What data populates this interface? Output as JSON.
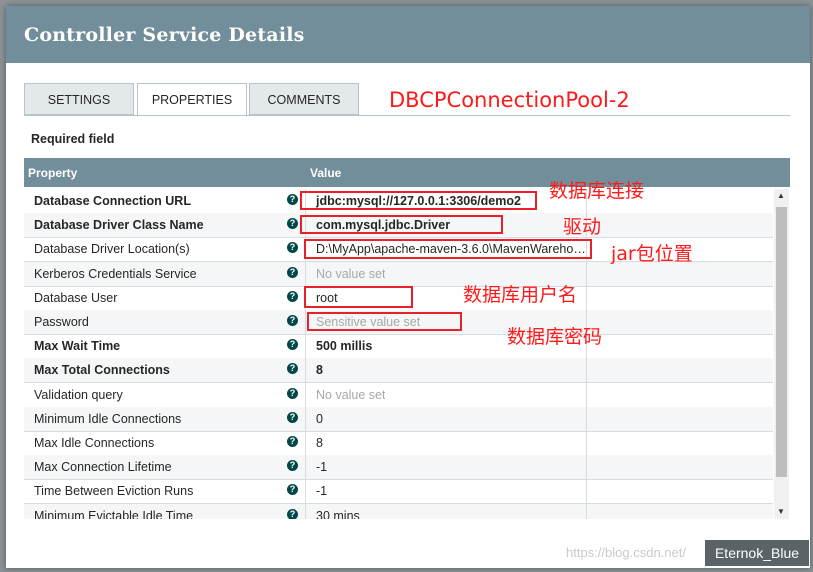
{
  "dialog": {
    "title": "Controller Service Details"
  },
  "tabs": [
    {
      "label": "SETTINGS",
      "active": false
    },
    {
      "label": "PROPERTIES",
      "active": true
    },
    {
      "label": "COMMENTS",
      "active": false
    }
  ],
  "annotation_title": "DBCPConnectionPool-2",
  "required_label": "Required field",
  "table": {
    "headers": {
      "property": "Property",
      "value": "Value"
    },
    "rows": [
      {
        "name": "Database Connection URL",
        "value": "jdbc:mysql://127.0.0.1:3306/demo2",
        "required": true,
        "empty": false
      },
      {
        "name": "Database Driver Class Name",
        "value": "com.mysql.jdbc.Driver",
        "required": true,
        "empty": false
      },
      {
        "name": "Database Driver Location(s)",
        "value": "D:\\MyApp\\apache-maven-3.6.0\\MavenWarehous...",
        "required": false,
        "empty": false
      },
      {
        "name": "Kerberos Credentials Service",
        "value": "No value set",
        "required": false,
        "empty": true
      },
      {
        "name": "Database User",
        "value": "root",
        "required": false,
        "empty": false
      },
      {
        "name": "Password",
        "value": "Sensitive value set",
        "required": false,
        "empty": true
      },
      {
        "name": "Max Wait Time",
        "value": "500 millis",
        "required": true,
        "empty": false
      },
      {
        "name": "Max Total Connections",
        "value": "8",
        "required": true,
        "empty": false
      },
      {
        "name": "Validation query",
        "value": "No value set",
        "required": false,
        "empty": true
      },
      {
        "name": "Minimum Idle Connections",
        "value": "0",
        "required": false,
        "empty": false
      },
      {
        "name": "Max Idle Connections",
        "value": "8",
        "required": false,
        "empty": false
      },
      {
        "name": "Max Connection Lifetime",
        "value": "-1",
        "required": false,
        "empty": false
      },
      {
        "name": "Time Between Eviction Runs",
        "value": "-1",
        "required": false,
        "empty": false
      },
      {
        "name": "Minimum Evictable Idle Time",
        "value": "30 mins",
        "required": false,
        "empty": false
      }
    ]
  },
  "annotations": {
    "url": "数据库连接",
    "driver": "驱动",
    "jar": "jar包位置",
    "user": "数据库用户名",
    "password": "数据库密码"
  },
  "watermark": {
    "text": "https://blog.csdn.net/",
    "badge": "Eternok_Blue"
  },
  "colors": {
    "header": "#728e9b",
    "annotation": "#ff1a1a",
    "help_icon": "#004849"
  }
}
